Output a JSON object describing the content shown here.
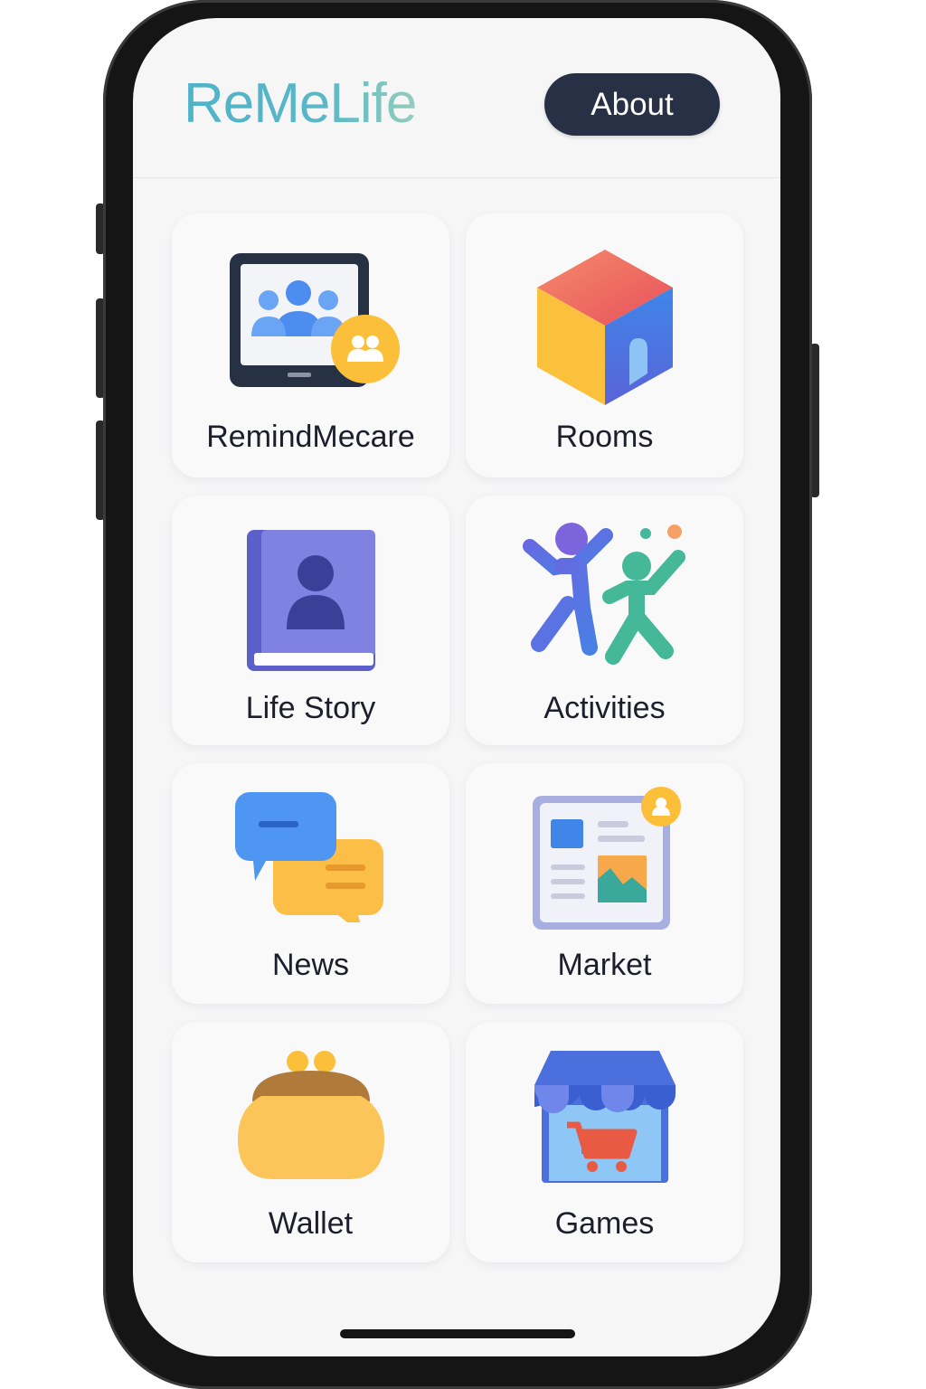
{
  "app": {
    "logo": "ReMeLife",
    "about_label": "About"
  },
  "tiles": [
    {
      "label": "RemindMecare",
      "icon": "group-tablet-icon"
    },
    {
      "label": "Rooms",
      "icon": "cube-house-icon"
    },
    {
      "label": "Life Story",
      "icon": "person-book-icon"
    },
    {
      "label": "Activities",
      "icon": "dancing-people-icon"
    },
    {
      "label": "News",
      "icon": "chat-bubbles-icon"
    },
    {
      "label": "Market",
      "icon": "newspaper-icon"
    },
    {
      "label": "Wallet",
      "icon": "coin-purse-icon"
    },
    {
      "label": "Games",
      "icon": "store-cart-icon"
    }
  ],
  "colors": {
    "logo_teal": "#4fb3c9",
    "about_button": "#283046",
    "screen_background": "#f6f6f7"
  }
}
